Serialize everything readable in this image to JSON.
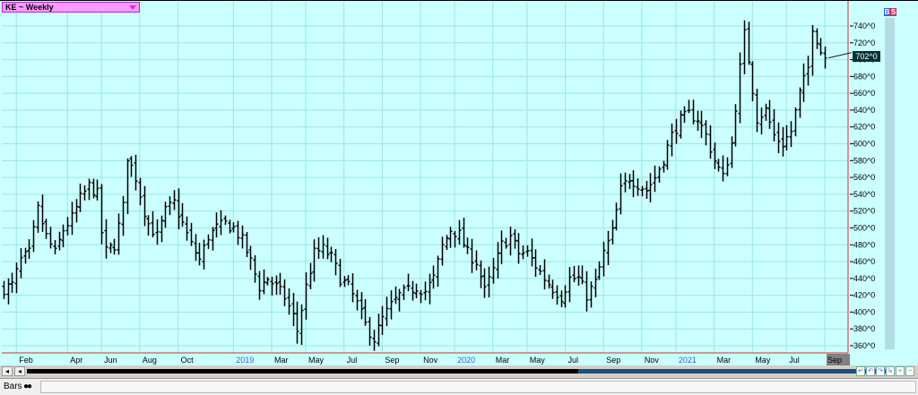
{
  "symbol": {
    "label": "KE ~ Weekly"
  },
  "badges": {
    "b": "B",
    "s": "S"
  },
  "last_price": "702^0",
  "bottom": {
    "style_label": "Bars"
  },
  "colors": {
    "background": "#ccffff",
    "grid": "#99e6e6",
    "bar": "#000000",
    "border": "#cc3333",
    "year_label": "#3366cc"
  },
  "chart_data": {
    "type": "ohlc",
    "title": "KE ~ Weekly",
    "ylim": [
      350,
      760
    ],
    "y_ticks": [
      {
        "value": 740,
        "label": "740^0"
      },
      {
        "value": 720,
        "label": "720^0"
      },
      {
        "value": 700,
        "label": "700^0"
      },
      {
        "value": 680,
        "label": "680^0"
      },
      {
        "value": 660,
        "label": "660^0"
      },
      {
        "value": 640,
        "label": "640^0"
      },
      {
        "value": 620,
        "label": "620^0"
      },
      {
        "value": 600,
        "label": "600^0"
      },
      {
        "value": 580,
        "label": "580^0"
      },
      {
        "value": 560,
        "label": "560^0"
      },
      {
        "value": 540,
        "label": "540^0"
      },
      {
        "value": 520,
        "label": "520^0"
      },
      {
        "value": 500,
        "label": "500^0"
      },
      {
        "value": 480,
        "label": "480^0"
      },
      {
        "value": 460,
        "label": "460^0"
      },
      {
        "value": 440,
        "label": "440^0"
      },
      {
        "value": 420,
        "label": "420^0"
      },
      {
        "value": 400,
        "label": "400^0"
      },
      {
        "value": 380,
        "label": "380^0"
      },
      {
        "value": 360,
        "label": "360^0"
      }
    ],
    "x_ticks": [
      {
        "week": 3,
        "label": "Feb",
        "year": false
      },
      {
        "week": 15,
        "label": "Apr",
        "year": false
      },
      {
        "week": 23,
        "label": "Jun",
        "year": false
      },
      {
        "week": 32,
        "label": "Aug",
        "year": false
      },
      {
        "week": 41,
        "label": "Oct",
        "year": false
      },
      {
        "week": 54,
        "label": "2019",
        "year": true
      },
      {
        "week": 63,
        "label": "Mar",
        "year": false
      },
      {
        "week": 71,
        "label": "May",
        "year": false
      },
      {
        "week": 80,
        "label": "Jul",
        "year": false
      },
      {
        "week": 89,
        "label": "Sep",
        "year": false
      },
      {
        "week": 98,
        "label": "Nov",
        "year": false
      },
      {
        "week": 106,
        "label": "2020",
        "year": true
      },
      {
        "week": 115,
        "label": "Mar",
        "year": false
      },
      {
        "week": 123,
        "label": "May",
        "year": false
      },
      {
        "week": 132,
        "label": "Jul",
        "year": false
      },
      {
        "week": 141,
        "label": "Sep",
        "year": false
      },
      {
        "week": 150,
        "label": "Nov",
        "year": false
      },
      {
        "week": 158,
        "label": "2021",
        "year": true
      },
      {
        "week": 167,
        "label": "Mar",
        "year": false
      },
      {
        "week": 176,
        "label": "May",
        "year": false
      },
      {
        "week": 184,
        "label": "Jul",
        "year": false
      },
      {
        "week": 193,
        "label": "Sep",
        "year": false
      }
    ],
    "waypoints": [
      [
        0,
        428
      ],
      [
        2,
        432
      ],
      [
        4,
        462
      ],
      [
        6,
        470
      ],
      [
        8,
        522
      ],
      [
        10,
        490
      ],
      [
        12,
        470
      ],
      [
        14,
        498
      ],
      [
        16,
        512
      ],
      [
        18,
        535
      ],
      [
        20,
        550
      ],
      [
        22,
        540
      ],
      [
        23,
        495
      ],
      [
        24,
        472
      ],
      [
        26,
        480
      ],
      [
        28,
        525
      ],
      [
        29,
        585
      ],
      [
        31,
        560
      ],
      [
        33,
        520
      ],
      [
        34,
        505
      ],
      [
        36,
        490
      ],
      [
        38,
        520
      ],
      [
        40,
        530
      ],
      [
        42,
        505
      ],
      [
        44,
        480
      ],
      [
        46,
        462
      ],
      [
        48,
        490
      ],
      [
        50,
        500
      ],
      [
        52,
        505
      ],
      [
        54,
        500
      ],
      [
        56,
        485
      ],
      [
        58,
        460
      ],
      [
        60,
        430
      ],
      [
        62,
        440
      ],
      [
        64,
        430
      ],
      [
        66,
        418
      ],
      [
        68,
        395
      ],
      [
        69,
        378
      ],
      [
        71,
        430
      ],
      [
        73,
        470
      ],
      [
        75,
        475
      ],
      [
        77,
        465
      ],
      [
        79,
        440
      ],
      [
        81,
        430
      ],
      [
        83,
        410
      ],
      [
        85,
        385
      ],
      [
        87,
        368
      ],
      [
        89,
        392
      ],
      [
        91,
        408
      ],
      [
        93,
        420
      ],
      [
        95,
        425
      ],
      [
        97,
        430
      ],
      [
        99,
        425
      ],
      [
        101,
        440
      ],
      [
        103,
        478
      ],
      [
        105,
        498
      ],
      [
        107,
        492
      ],
      [
        109,
        470
      ],
      [
        111,
        460
      ],
      [
        113,
        425
      ],
      [
        115,
        450
      ],
      [
        117,
        480
      ],
      [
        119,
        490
      ],
      [
        121,
        470
      ],
      [
        123,
        470
      ],
      [
        125,
        455
      ],
      [
        127,
        440
      ],
      [
        129,
        428
      ],
      [
        131,
        418
      ],
      [
        133,
        440
      ],
      [
        135,
        440
      ],
      [
        137,
        420
      ],
      [
        139,
        435
      ],
      [
        141,
        470
      ],
      [
        143,
        495
      ],
      [
        145,
        545
      ],
      [
        147,
        560
      ],
      [
        149,
        552
      ],
      [
        151,
        545
      ],
      [
        153,
        560
      ],
      [
        155,
        582
      ],
      [
        157,
        610
      ],
      [
        159,
        628
      ],
      [
        161,
        635
      ],
      [
        163,
        630
      ],
      [
        165,
        610
      ],
      [
        167,
        580
      ],
      [
        169,
        560
      ],
      [
        171,
        600
      ],
      [
        173,
        690
      ],
      [
        174,
        730
      ],
      [
        175,
        700
      ],
      [
        177,
        630
      ],
      [
        179,
        640
      ],
      [
        181,
        610
      ],
      [
        183,
        600
      ],
      [
        185,
        615
      ],
      [
        187,
        660
      ],
      [
        189,
        690
      ],
      [
        190,
        740
      ],
      [
        192,
        710
      ],
      [
        193,
        700
      ]
    ],
    "last": 702
  }
}
